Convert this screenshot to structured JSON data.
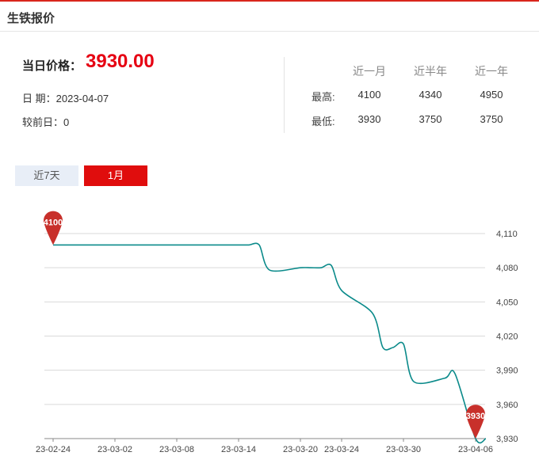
{
  "header": {
    "title": "生铁报价"
  },
  "summary": {
    "price_label": "当日价格：",
    "price_value": "3930.00",
    "date_label": "日 期：",
    "date_value": "2023-04-07",
    "change_label": "较前日：",
    "change_value": "0"
  },
  "stats": {
    "columns": [
      "近一月",
      "近半年",
      "近一年"
    ],
    "rows": [
      {
        "label": "最高:",
        "values": [
          "4100",
          "4340",
          "4950"
        ]
      },
      {
        "label": "最低:",
        "values": [
          "3930",
          "3750",
          "3750"
        ]
      }
    ]
  },
  "tabs": [
    {
      "label": "近7天",
      "active": false
    },
    {
      "label": "1月",
      "active": true
    }
  ],
  "colors": {
    "accent": "#e00d0d",
    "line": "#0a8a8a",
    "marker": "#c8302b"
  },
  "chart_data": {
    "type": "line",
    "title": "",
    "xlabel": "",
    "ylabel": "",
    "ylim": [
      3930,
      4110
    ],
    "yticks": [
      "3,930",
      "3,960",
      "3,990",
      "4,020",
      "4,050",
      "4,080",
      "4,110"
    ],
    "ytick_values": [
      3930,
      3960,
      3990,
      4020,
      4050,
      4080,
      4110
    ],
    "xticks": [
      "23-02-24",
      "23-03-02",
      "23-03-08",
      "23-03-14",
      "23-03-20",
      "23-03-24",
      "23-03-30",
      "23-04-06"
    ],
    "grid": true,
    "y_axis_position": "right",
    "series": [
      {
        "dates": [
          "2023-02-24",
          "2023-02-27",
          "2023-02-28",
          "2023-03-01",
          "2023-03-02",
          "2023-03-03",
          "2023-03-06",
          "2023-03-07",
          "2023-03-08",
          "2023-03-09",
          "2023-03-10",
          "2023-03-13",
          "2023-03-14",
          "2023-03-15",
          "2023-03-16",
          "2023-03-17",
          "2023-03-20",
          "2023-03-21",
          "2023-03-22",
          "2023-03-23",
          "2023-03-24",
          "2023-03-27",
          "2023-03-28",
          "2023-03-29",
          "2023-03-30",
          "2023-03-31",
          "2023-04-03",
          "2023-04-04",
          "2023-04-06",
          "2023-04-07"
        ],
        "values": [
          4100,
          4100,
          4100,
          4100,
          4100,
          4100,
          4100,
          4100,
          4100,
          4100,
          4100,
          4100,
          4100,
          4100,
          4100,
          4078,
          4080,
          4080,
          4080,
          4082,
          4060,
          4040,
          4010,
          4010,
          4013,
          3980,
          3983,
          3987,
          3930,
          3930
        ]
      }
    ],
    "annotations": [
      {
        "label": "4100",
        "kind": "max",
        "index": 0
      },
      {
        "label": "3930",
        "kind": "min",
        "index": 28
      }
    ]
  }
}
